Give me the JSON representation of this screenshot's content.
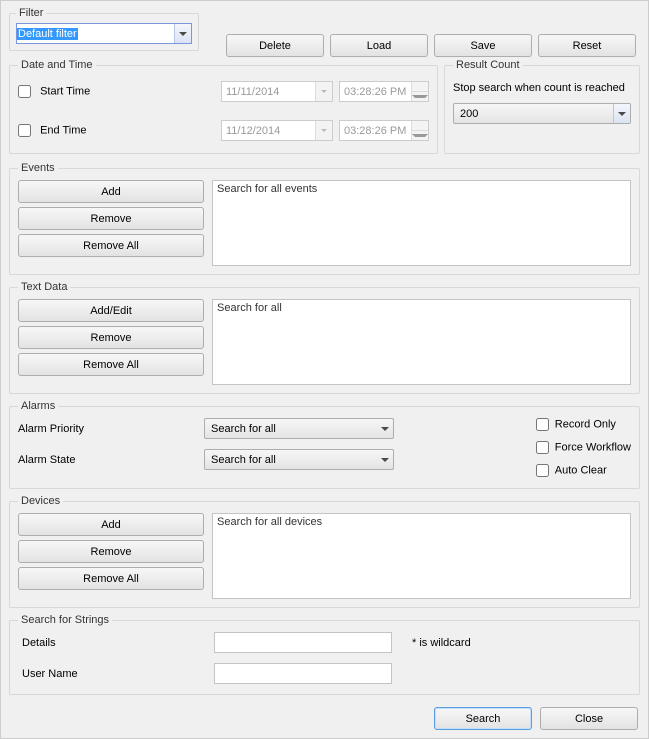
{
  "filter": {
    "legend": "Filter",
    "selected": "Default filter",
    "buttons": {
      "delete": "Delete",
      "load": "Load",
      "save": "Save",
      "reset": "Reset"
    }
  },
  "date_time": {
    "legend": "Date and Time",
    "start_label": "Start Time",
    "end_label": "End Time",
    "start_date": "11/11/2014",
    "start_time": "03:28:26 PM",
    "end_date": "11/12/2014",
    "end_time": "03:28:26 PM"
  },
  "result_count": {
    "legend": "Result Count",
    "desc": "Stop search when count is reached",
    "value": "200"
  },
  "events": {
    "legend": "Events",
    "add": "Add",
    "remove": "Remove",
    "remove_all": "Remove All",
    "list_text": "Search for all events"
  },
  "text_data": {
    "legend": "Text Data",
    "add_edit": "Add/Edit",
    "remove": "Remove",
    "remove_all": "Remove All",
    "list_text": "Search for all"
  },
  "alarms": {
    "legend": "Alarms",
    "priority_label": "Alarm Priority",
    "state_label": "Alarm State",
    "priority_value": "Search for all",
    "state_value": "Search for all",
    "record_only": "Record Only",
    "force_workflow": "Force Workflow",
    "auto_clear": "Auto Clear"
  },
  "devices": {
    "legend": "Devices",
    "add": "Add",
    "remove": "Remove",
    "remove_all": "Remove All",
    "list_text": "Search for all devices"
  },
  "strings": {
    "legend": "Search for Strings",
    "details_label": "Details",
    "user_label": "User Name",
    "wildcard_hint": "* is wildcard"
  },
  "footer": {
    "search": "Search",
    "close": "Close"
  }
}
